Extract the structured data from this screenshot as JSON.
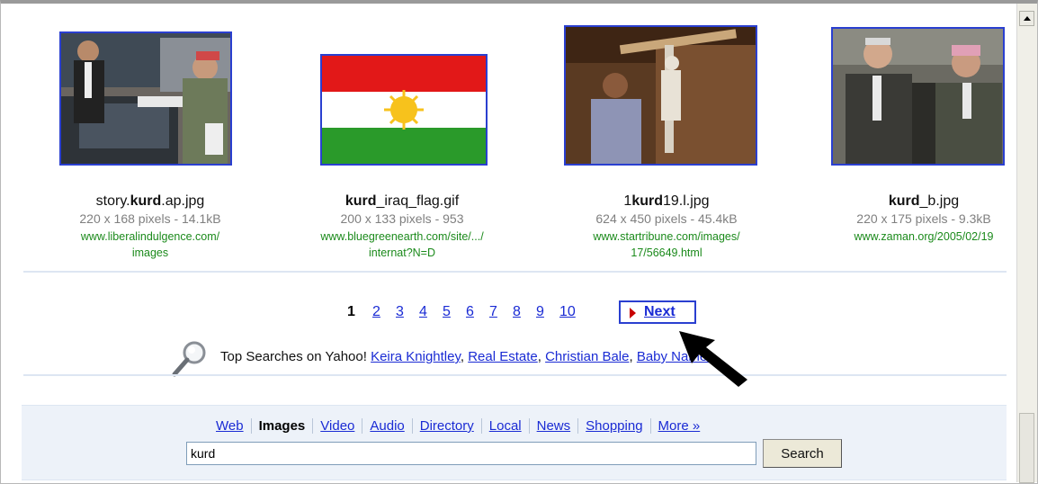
{
  "results": [
    {
      "name_pre": "story.",
      "name_bold": "kurd",
      "name_post": ".ap.jpg",
      "meta": "220 x 168 pixels - 14.1kB",
      "url1": "www.liberalindulgence.com/",
      "url2": "images"
    },
    {
      "name_pre": "",
      "name_bold": "kurd",
      "name_post": "_iraq_flag.gif",
      "meta": "200 x 133 pixels - 953",
      "url1": "www.bluegreenearth.com/site/.../",
      "url2": "internat?N=D"
    },
    {
      "name_pre": "1",
      "name_bold": "kurd",
      "name_post": "19.l.jpg",
      "meta": "624 x 450 pixels - 45.4kB",
      "url1": "www.startribune.com/images/",
      "url2": "17/56649.html"
    },
    {
      "name_pre": "",
      "name_bold": "kurd",
      "name_post": "_b.jpg",
      "meta": "220 x 175 pixels - 9.3kB",
      "url1": "www.zaman.org/2005/02/19",
      "url2": ""
    }
  ],
  "pagination": {
    "current": "1",
    "pages": [
      "2",
      "3",
      "4",
      "5",
      "6",
      "7",
      "8",
      "9",
      "10"
    ],
    "next_label": "Next"
  },
  "top_searches": {
    "prefix": "Top Searches on Yahoo!",
    "links": [
      "Keira Knightley",
      "Real Estate",
      "Christian Bale",
      "Baby Names"
    ]
  },
  "search": {
    "tabs": [
      "Web",
      "Images",
      "Video",
      "Audio",
      "Directory",
      "Local",
      "News",
      "Shopping",
      "More »"
    ],
    "active_tab": "Images",
    "query": "kurd",
    "button_label": "Search"
  },
  "colors": {
    "link": "#1a2bd4",
    "url_green": "#1b8a1b",
    "meta_gray": "#7f7f7f",
    "image_border": "#2a3fd0",
    "next_arrow": "#c80000"
  },
  "icons": [
    "magnifier-icon",
    "next-arrow-icon",
    "scroll-up-icon",
    "mouse-cursor-icon"
  ]
}
